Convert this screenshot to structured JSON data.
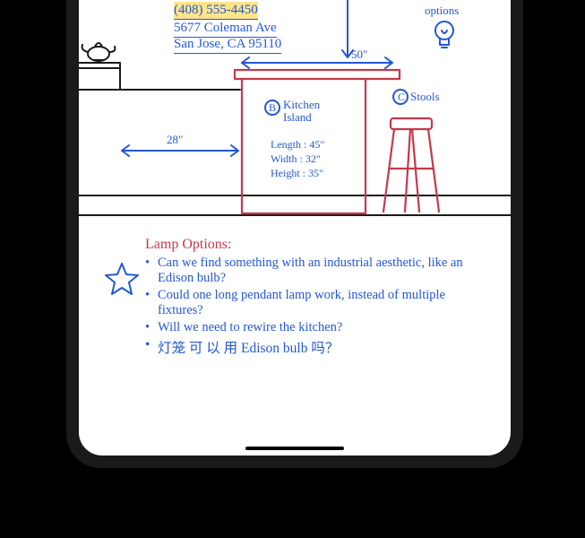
{
  "contact": {
    "phone": "(408) 555-4450",
    "address_line1": "5677 Coleman Ave",
    "address_line2": "San Jose, CA 95110"
  },
  "header_labels": {
    "options": "options"
  },
  "dimensions": {
    "top_width": "50\"",
    "left_gap": "28\""
  },
  "island": {
    "marker": "B",
    "title": "Kitchen Island",
    "length": "Length : 45\"",
    "width": "Width : 32\"",
    "height": "Height : 35\""
  },
  "stools": {
    "marker": "C",
    "label": "Stools"
  },
  "notes": {
    "title": "Lamp Options:",
    "items": [
      "Can we find something with an industrial aesthetic, like an Edison bulb?",
      "Could one long pendant lamp work, instead of multiple fixtures?",
      "Will we need to rewire the kitchen?",
      "灯笼 可 以 用 Edison bulb 吗？"
    ]
  }
}
